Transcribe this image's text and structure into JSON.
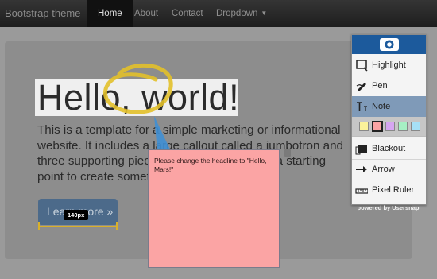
{
  "navbar": {
    "brand": "Bootstrap theme",
    "items": [
      {
        "label": "Home"
      },
      {
        "label": "About"
      },
      {
        "label": "Contact"
      },
      {
        "label": "Dropdown"
      }
    ]
  },
  "jumbotron": {
    "headline": "Hello, world!",
    "lead": "This is a template for a simple marketing or informational website. It includes a large callout called a jumbotron and three supporting pieces of content. Use it as a starting point to create something more unique.",
    "button_label": "Learn more »"
  },
  "ruler": {
    "label": "140px"
  },
  "note": {
    "text": "Please change the headline to \"Hello, Mars!\""
  },
  "toolbar": {
    "tools": [
      {
        "label": "Highlight",
        "icon": "highlight-icon"
      },
      {
        "label": "Pen",
        "icon": "pen-icon"
      },
      {
        "label": "Note",
        "icon": "note-icon"
      },
      {
        "label": "Blackout",
        "icon": "blackout-icon"
      },
      {
        "label": "Arrow",
        "icon": "arrow-icon"
      },
      {
        "label": "Pixel Ruler",
        "icon": "ruler-icon"
      }
    ],
    "selected_tool": "Note",
    "swatches": [
      "#fbf29a",
      "#fba4a4",
      "#d6a6f1",
      "#a6f0c4",
      "#a6e0f6"
    ],
    "selected_swatch": "#fba4a4",
    "powered_by": "powered by Usersnap"
  },
  "colors": {
    "annotation_circle": "#e2c02a",
    "annotation_arrow": "#3f8fd4",
    "toolbar_header": "#1c5a9c"
  }
}
